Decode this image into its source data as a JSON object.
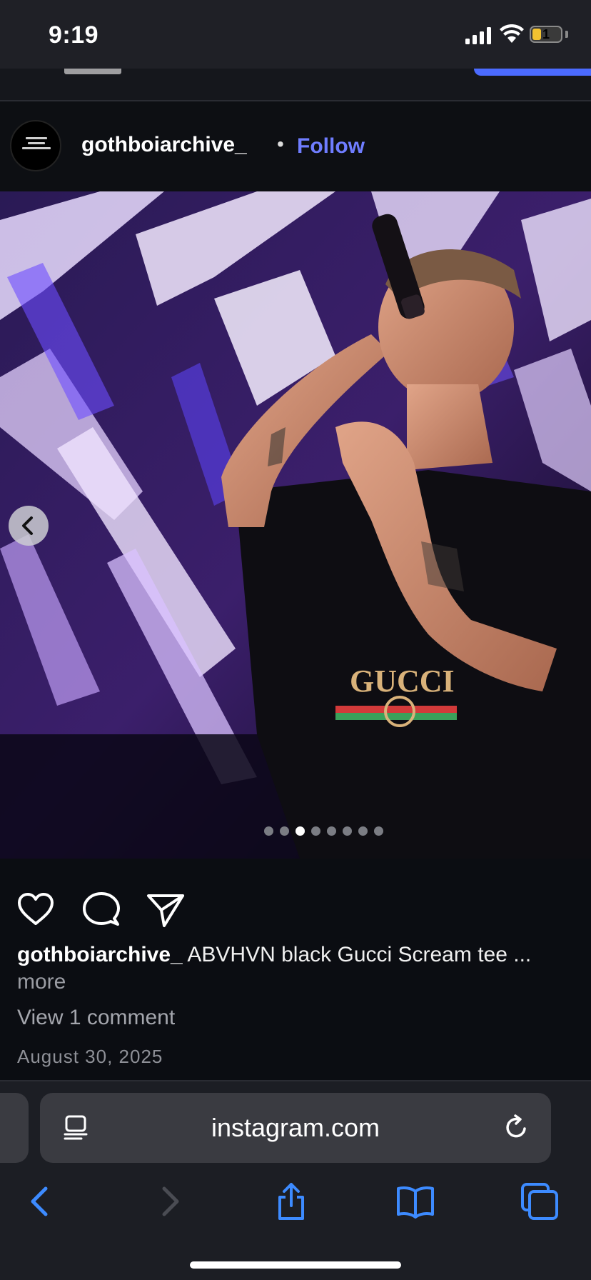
{
  "status_bar": {
    "time": "9:19",
    "battery": "1",
    "icons": [
      "cellular-signal-icon",
      "wifi-icon",
      "battery-icon"
    ]
  },
  "post": {
    "username": "gothboiarchive_",
    "separator": "•",
    "follow_label": "Follow",
    "carousel": {
      "total": 8,
      "active_index": 2
    },
    "actions": [
      "heart-icon",
      "comment-icon",
      "share-icon"
    ],
    "caption_user": "gothboiarchive_",
    "caption_text": "ABVHVN black Gucci Scream tee ...",
    "more_label": "more",
    "comments_label": "View 1 comment",
    "date": "August 30, 2025",
    "image_print_text": "GUCCI"
  },
  "browser": {
    "url": "instagram.com",
    "toolbar": [
      "back-icon",
      "forward-icon",
      "share-icon",
      "bookmarks-icon",
      "tabs-icon"
    ]
  },
  "colors": {
    "background": "#0b0d12",
    "accent_follow": "#6f7dff",
    "safari_accent": "#3d8bff"
  }
}
